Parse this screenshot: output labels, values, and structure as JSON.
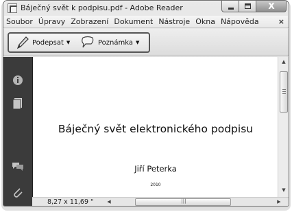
{
  "window": {
    "title": "Báječný svět k podpisu.pdf - Adobe Reader"
  },
  "caption_buttons": {
    "close_glyph": "X"
  },
  "menu": {
    "items": [
      {
        "label": "Soubor"
      },
      {
        "label": "Úpravy"
      },
      {
        "label": "Zobrazení"
      },
      {
        "label": "Dokument"
      },
      {
        "label": "Nástroje"
      },
      {
        "label": "Okna"
      },
      {
        "label": "Nápověda"
      }
    ],
    "close_glyph": "×"
  },
  "toolbar": {
    "sign_label": "Podepsat",
    "note_label": "Poznámka"
  },
  "sidebar": {
    "icons": [
      "info-icon",
      "pages-icon",
      "comments-icon",
      "attachment-icon"
    ]
  },
  "document": {
    "title": "Báječný svět elektronického podpisu",
    "author": "Jiří Peterka",
    "year": "2010"
  },
  "status": {
    "page_size": "8,27 x 11,69 \""
  },
  "colors": {
    "sidebar_bg": "#3b3b3b",
    "toolgroup_border": "#555555"
  }
}
